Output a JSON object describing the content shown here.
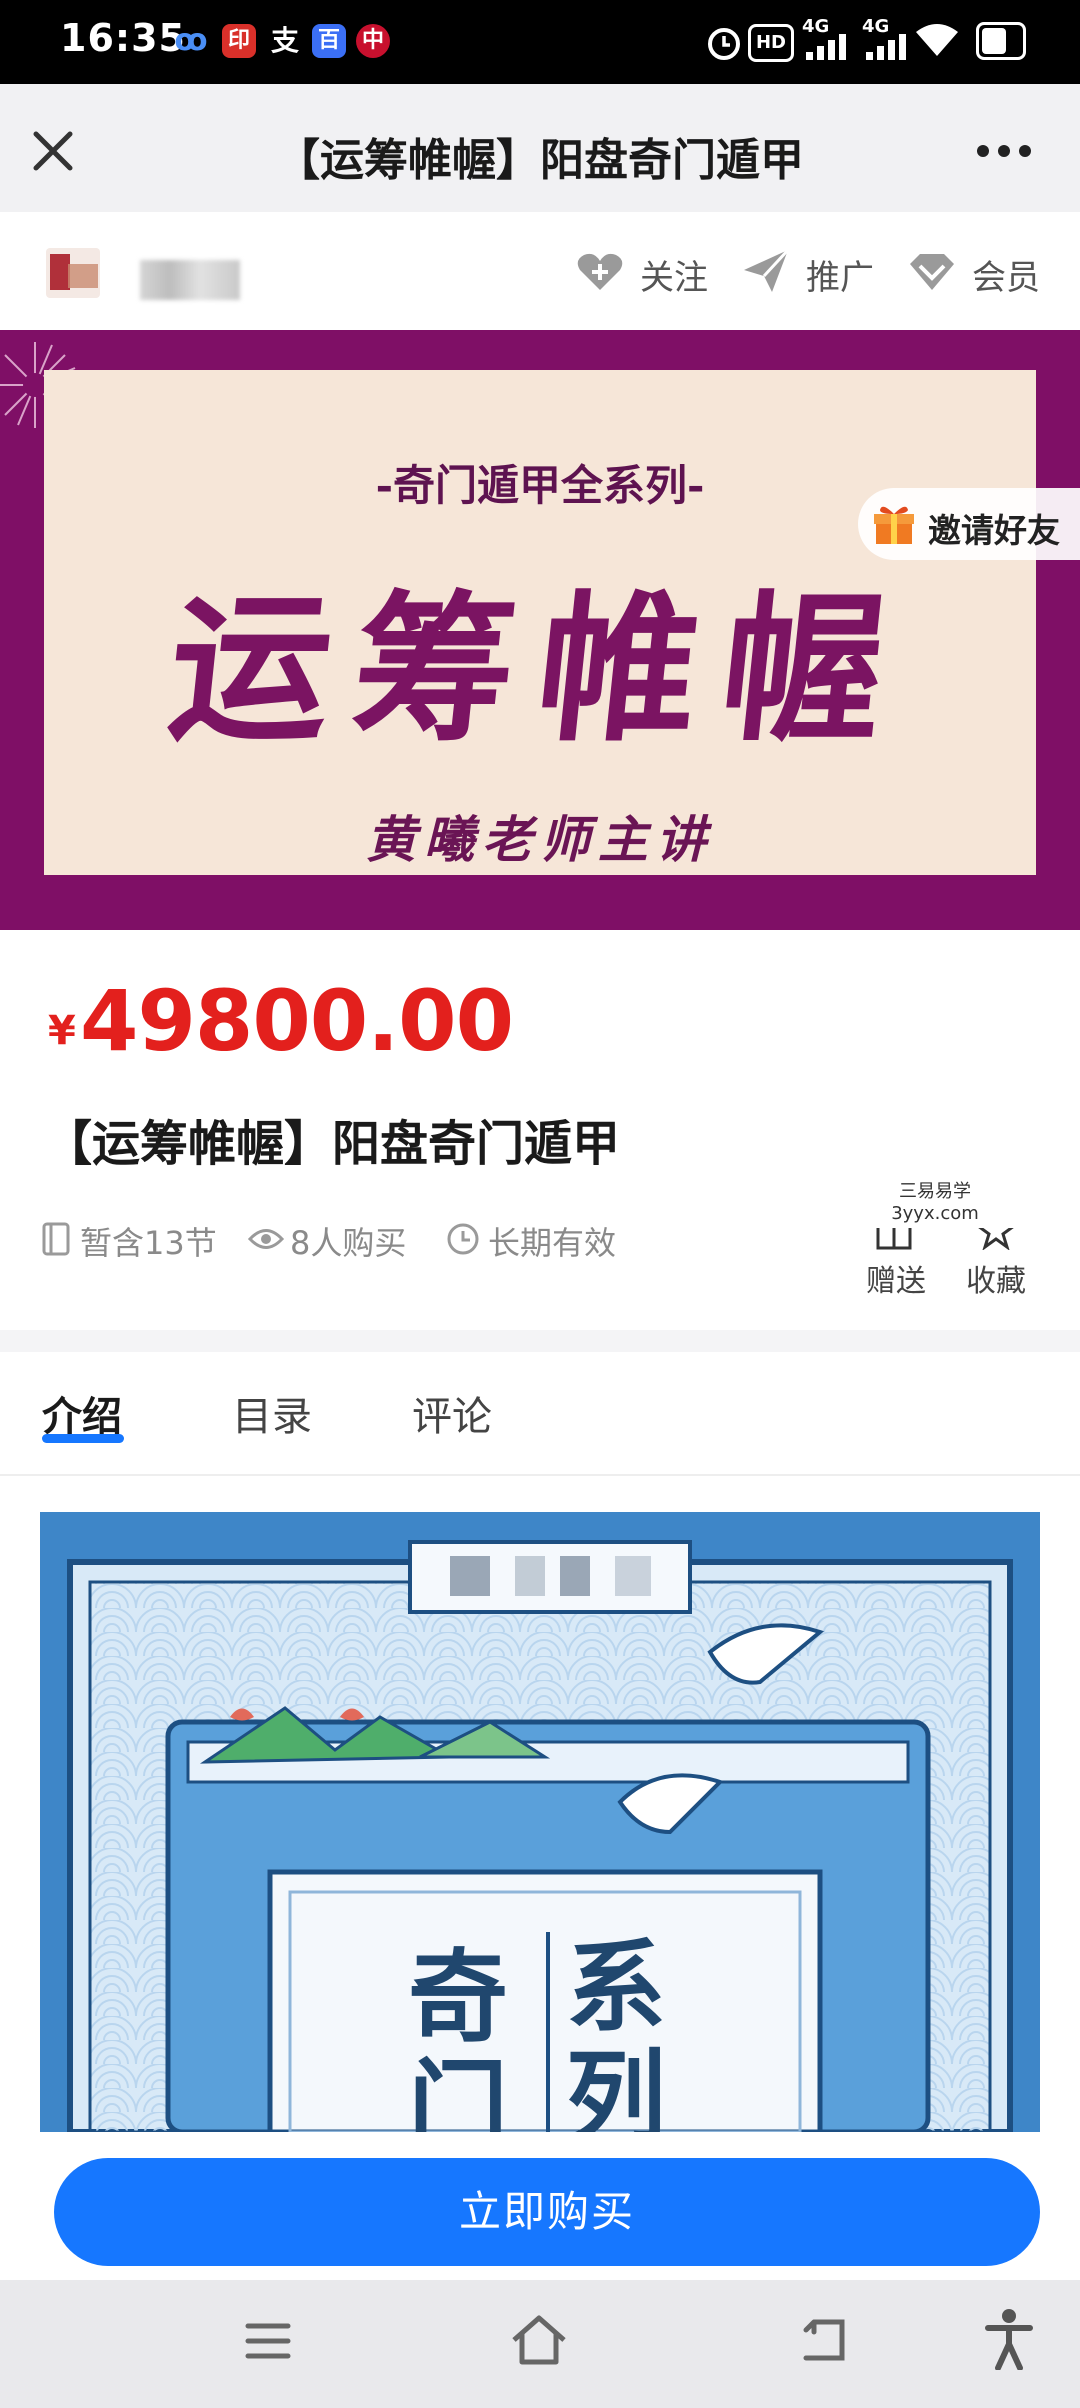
{
  "status_bar": {
    "time": "16:35",
    "app_icons": [
      {
        "name": "cloud-icon",
        "glyph": "ꝏ",
        "color": "#4a8ef5"
      },
      {
        "name": "seal-app-icon",
        "glyph": "印",
        "color": "#d9302a"
      },
      {
        "name": "alipay-icon",
        "glyph": "支",
        "color": "#ffffff"
      },
      {
        "name": "baidu-icon",
        "glyph": "百",
        "color": "#3b6ff5"
      },
      {
        "name": "bank-icon",
        "glyph": "中",
        "color": "#c8102e"
      }
    ],
    "hd_label": "HD",
    "network_1": "4G",
    "network_2": "4G"
  },
  "titlebar": {
    "title": "【运筹帷幄】阳盘奇门遁甲",
    "close_icon": "close-icon",
    "more_icon": "more-icon"
  },
  "author_row": {
    "actions": [
      {
        "label": "关注",
        "icon": "heart-plus-icon"
      },
      {
        "label": "推广",
        "icon": "send-icon"
      },
      {
        "label": "会员",
        "icon": "vip-diamond-icon"
      }
    ]
  },
  "banner": {
    "subtitle": "-奇门遁甲全系列-",
    "title": "运筹帷幄",
    "lecturer": "黄曦老师主讲",
    "invite_label": "邀请好友"
  },
  "product": {
    "price_symbol": "¥",
    "price": "49800.00",
    "title": "【运筹帷幄】阳盘奇门遁甲",
    "meta": [
      {
        "icon": "lessons-icon",
        "text": "暂含13节"
      },
      {
        "icon": "eye-icon",
        "text": "8人购买"
      },
      {
        "icon": "clock-icon",
        "text": "长期有效"
      }
    ],
    "watermark_line1": "三易易学",
    "watermark_line2": "3yyx.com",
    "side_actions": [
      {
        "icon": "gift-icon",
        "label": "赠送"
      },
      {
        "icon": "star-icon",
        "label": "收藏"
      }
    ]
  },
  "tabs": [
    {
      "label": "介绍",
      "active": true
    },
    {
      "label": "目录",
      "active": false
    },
    {
      "label": "评论",
      "active": false
    }
  ],
  "intro_image": {
    "chars_left": [
      "奇",
      "门"
    ],
    "chars_right": [
      "系",
      "列"
    ]
  },
  "buy_bar": {
    "button_label": "立即购买"
  },
  "colors": {
    "accent_blue": "#1677ff",
    "price_red": "#e3201d",
    "banner_purple": "#7f0f66",
    "banner_cream": "#f6e6d8"
  }
}
